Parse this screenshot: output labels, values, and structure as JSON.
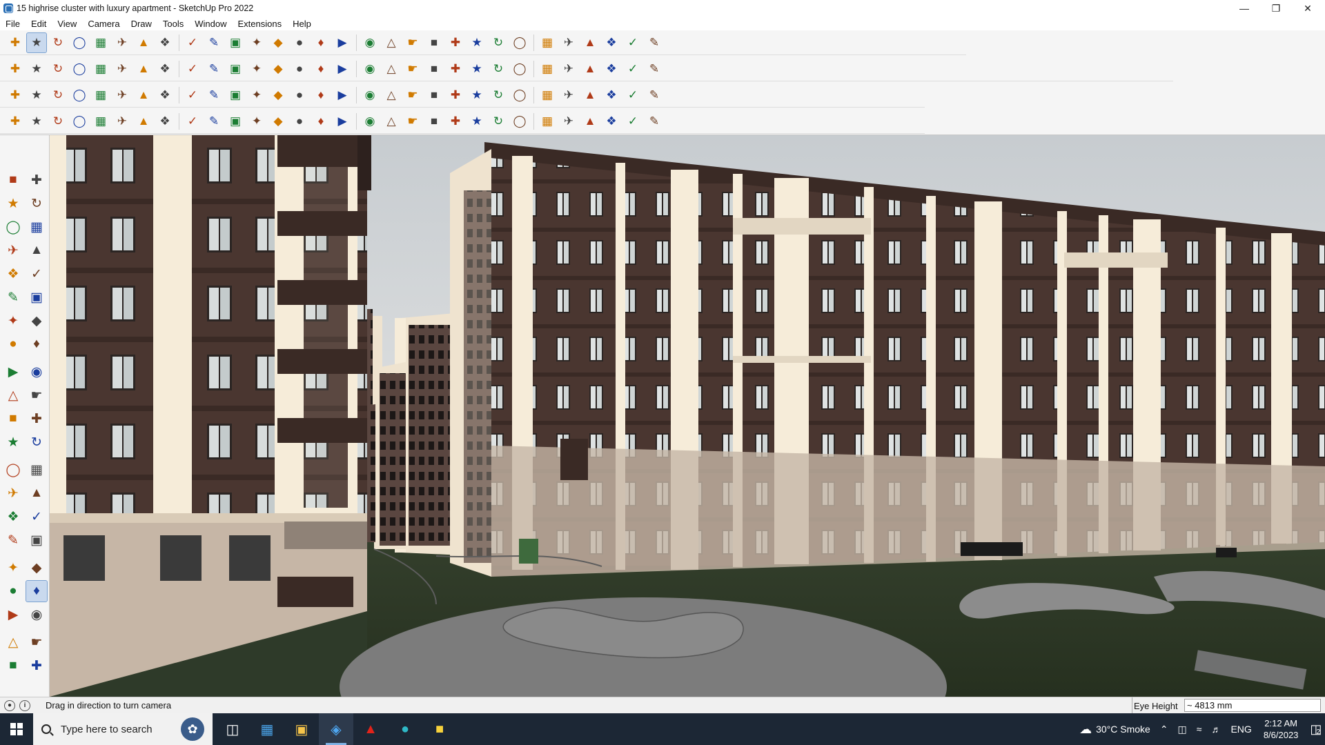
{
  "window": {
    "title": "15 highrise cluster with luxury apartment - SketchUp Pro 2022",
    "minimize_icon": "minimize-icon",
    "maximize_icon": "restore-icon",
    "close_icon": "close-icon"
  },
  "menu": {
    "items": [
      "File",
      "Edit",
      "View",
      "Camera",
      "Draw",
      "Tools",
      "Window",
      "Extensions",
      "Help"
    ]
  },
  "toolbars": {
    "row1": [
      "zoom",
      "select",
      "eraser",
      "pencil",
      "lasso",
      "rectangle",
      "push-pull",
      "follow-me",
      "move",
      "rotate",
      "scale",
      "tape",
      "text",
      "paint",
      "orbit",
      "pan",
      "zoom-in",
      "zoom-extents",
      "component",
      "sandbox",
      "layers",
      "styles",
      "user",
      "geo",
      "dims",
      "section",
      "axes",
      "undo",
      "redo",
      "warehouse"
    ],
    "row2": [
      "iso",
      "top",
      "front",
      "right",
      "back",
      "left",
      "bottom",
      "extrude",
      "push",
      "offset",
      "fillet",
      "chamfer",
      "round",
      "split",
      "cut",
      "weld",
      "join",
      "bevel",
      "line-x",
      "plane",
      "house",
      "roof",
      "wall",
      "stair",
      "door",
      "window",
      "curtain",
      "column",
      "beam",
      "slab"
    ],
    "row3": [
      "blue-poly",
      "blue-shape",
      "yellow-shape",
      "green-shape",
      "red-shape",
      "white-shape",
      "spiral",
      "red-box",
      "frame",
      "board",
      "wood",
      "plugin",
      "sketch",
      "grid",
      "plus-green",
      "cross-blue",
      "cone",
      "vertex",
      "knot",
      "link",
      "star",
      "tube",
      "pipe",
      "loop",
      "helix",
      "array",
      "spring",
      "bend",
      "twist",
      "square"
    ],
    "row4": [
      "curve",
      "bezier",
      "spline",
      "cut-tool",
      "gear",
      "outline",
      "slice",
      "cloth",
      "rope",
      "hook",
      "arc",
      "rail",
      "trim",
      "extend",
      "flip",
      "mirror",
      "stack",
      "stripes",
      "fence",
      "comb",
      "skew",
      "lathe",
      "taper",
      "shell",
      "lattice",
      "mesh",
      "trees",
      "hatch",
      "shade",
      "leaf"
    ],
    "selected": {
      "row1": 1
    }
  },
  "left_toolbar": {
    "tools": [
      "select",
      "orbit",
      "paint",
      "eraser",
      "component",
      "tape",
      "line",
      "freehand",
      "rectangle",
      "rotated-rect",
      "circle",
      "polygon",
      "arc",
      "pie",
      "3pt-arc",
      "2pt-arc",
      "move",
      "push-pull",
      "rotate",
      "follow-me",
      "scale",
      "offset",
      "tape-measure",
      "text",
      "protractor",
      "dimension",
      "axes",
      "3d-text",
      "orbit-2",
      "pan",
      "zoom",
      "zoom-window",
      "zoom-extents",
      "previous",
      "position-camera",
      "look-around",
      "walk",
      "section-plane",
      "tag-1",
      "tag-2",
      "tag-3",
      "tag-4"
    ],
    "selected": 35
  },
  "status": {
    "hint": "Drag in direction to turn camera",
    "measure_label": "Eye Height",
    "measure_value": "~ 4813 mm"
  },
  "taskbar": {
    "search_placeholder": "Type here to search",
    "apps": [
      "task-view",
      "calculator",
      "file-explorer",
      "sketchup",
      "acrobat",
      "edge",
      "sticky-notes"
    ],
    "weather": "30°C  Smoke",
    "language": "ENG",
    "time": "2:12 AM",
    "date": "8/6/2023",
    "notification_count": "2"
  },
  "colors": {
    "sky": "#cfd3d6",
    "brick": "#4a3630",
    "cream": "#f6ecd9",
    "ground": "#2e3a29",
    "plaza": "#7c7c7c",
    "taskbar": "#1c2735"
  }
}
